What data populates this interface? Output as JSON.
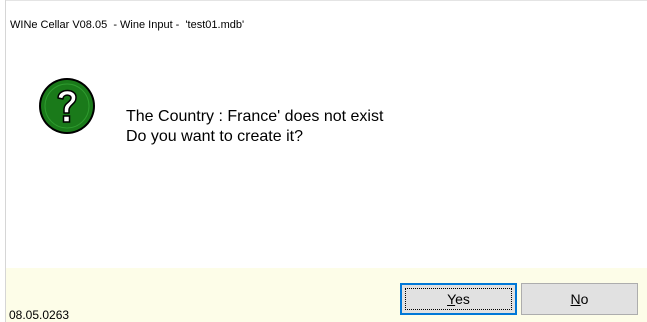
{
  "window": {
    "title": "WINe Cellar V08.05  - Wine Input -  'test01.mdb'"
  },
  "dialog": {
    "icon": "question-icon",
    "icon_color": "#1a7a1a",
    "message_line1": "The Country : France' does not exist",
    "message_line2": "Do you want to create it?"
  },
  "footer": {
    "version": "08.05.0263",
    "background_color": "#fdfde8"
  },
  "buttons": {
    "yes_mnemonic": "Y",
    "yes_rest": "es",
    "no_mnemonic": "N",
    "no_rest": "o"
  }
}
